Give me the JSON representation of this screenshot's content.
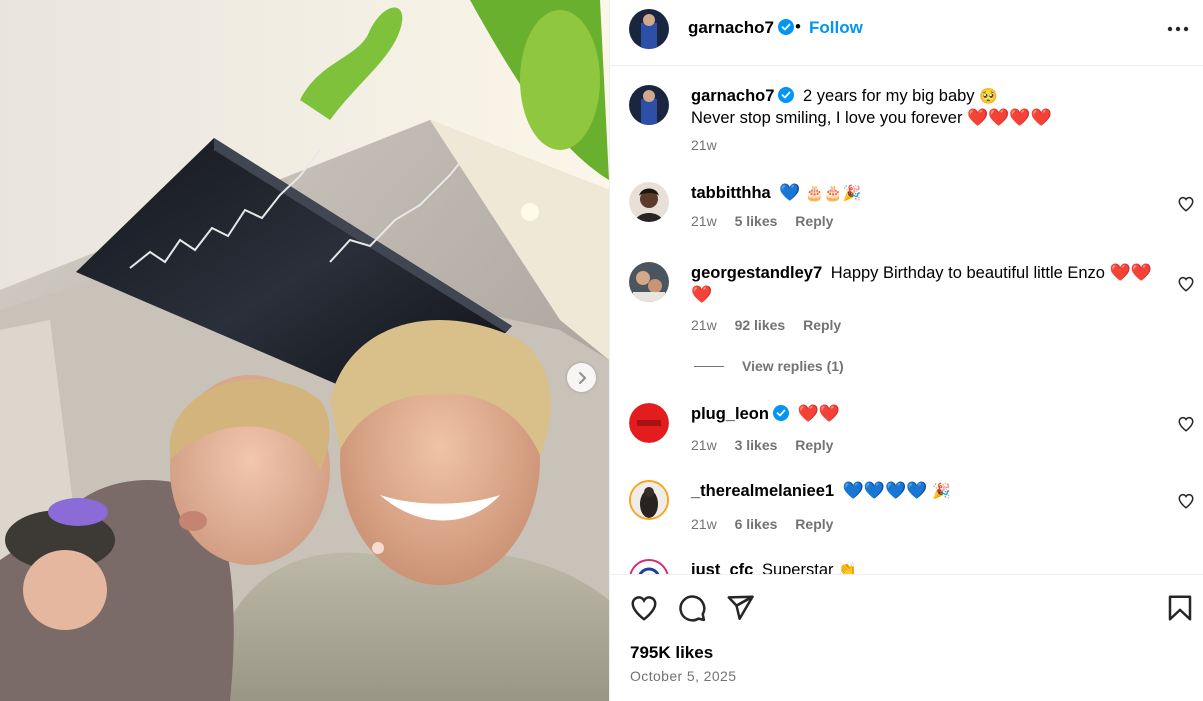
{
  "post": {
    "username": "garnacho7",
    "follow_label": "Follow",
    "separator": "•",
    "caption_line1": "2 years for my big baby",
    "caption_emoji1": "🥺",
    "caption_line2": "Never stop smiling, I love you forever",
    "caption_emoji2": "❤️❤️❤️❤️",
    "caption_time": "21w",
    "likes": "795K likes",
    "date": "October 5, 2025"
  },
  "comments": [
    {
      "username": "tabbitthha",
      "text": "",
      "emoji_blue": "💙",
      "emoji_misc": "🎂🎂🎉",
      "time": "21w",
      "likes": "5 likes",
      "reply": "Reply"
    },
    {
      "username": "georgestandley7",
      "text": "Happy Birthday to beautiful little Enzo",
      "emoji_red": "❤️❤️❤️",
      "time": "21w",
      "likes": "92 likes",
      "reply": "Reply",
      "view_replies": "View replies (1)"
    },
    {
      "username": "plug_leon",
      "text": "",
      "emoji_red": "❤️❤️",
      "time": "21w",
      "likes": "3 likes",
      "reply": "Reply",
      "verified": true
    },
    {
      "username": "_therealmelaniee1",
      "text": "",
      "emoji_blue": "💙💙💙💙",
      "emoji_misc": "🎉",
      "time": "21w",
      "likes": "6 likes",
      "reply": "Reply"
    },
    {
      "username": "just_cfc",
      "text": "Superstar",
      "emoji_misc": "👏"
    }
  ],
  "colors": {
    "accent": "#0095f6",
    "verified": "#0095f6",
    "meta": "#737373",
    "heart_red": "#e0243a"
  },
  "icons": {
    "like": "heart-icon",
    "comment": "comment-icon",
    "share": "paper-plane-icon",
    "save": "bookmark-icon",
    "more": "more-options-icon",
    "next": "chevron-right-icon"
  }
}
